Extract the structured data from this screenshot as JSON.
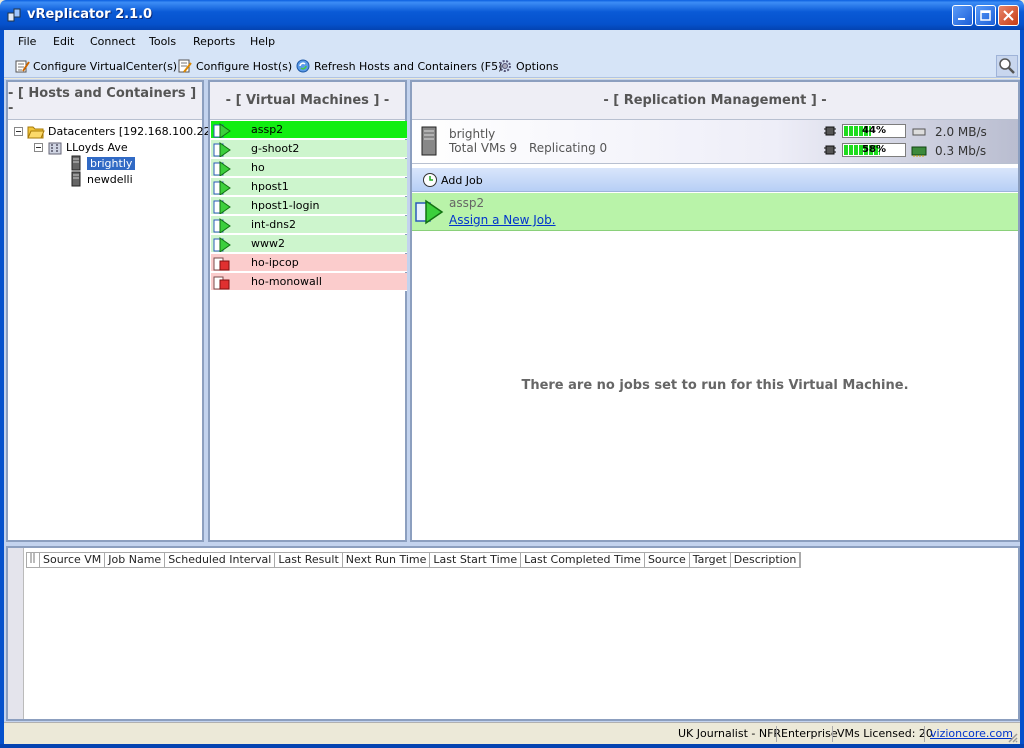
{
  "window": {
    "title": "vReplicator 2.1.0"
  },
  "menu": [
    "File",
    "Edit",
    "Connect",
    "Tools",
    "Reports",
    "Help"
  ],
  "toolbar": {
    "configure_vc": "Configure VirtualCenter(s)",
    "configure_hosts": "Configure Host(s)",
    "refresh": "Refresh Hosts and Containers (F5)",
    "options": "Options"
  },
  "panels": {
    "hosts": "- [ Hosts and Containers ] -",
    "vms": "- [ Virtual Machines ] -",
    "replication": "- [ Replication Management ] -"
  },
  "tree": {
    "root": "Datacenters [192.168.100.22]",
    "site": "LLoyds Ave",
    "hosts": [
      "brightly",
      "newdelli"
    ]
  },
  "vms": [
    {
      "name": "assp2",
      "state": "selected"
    },
    {
      "name": "g-shoot2",
      "state": "on"
    },
    {
      "name": "ho",
      "state": "on"
    },
    {
      "name": "hpost1",
      "state": "on"
    },
    {
      "name": "hpost1-login",
      "state": "on"
    },
    {
      "name": "int-dns2",
      "state": "on"
    },
    {
      "name": "www2",
      "state": "on"
    },
    {
      "name": "ho-ipcop",
      "state": "off"
    },
    {
      "name": "ho-monowall",
      "state": "off"
    }
  ],
  "host_info": {
    "name": "brightly",
    "total_vms": "Total VMs 9",
    "replicating": "Replicating 0",
    "cpu_pct": "44%",
    "cpu_level": 0.44,
    "mem_pct": "58%",
    "mem_level": 0.58,
    "disk_rate": "2.0 MB/s",
    "net_rate": "0.3 Mb/s"
  },
  "jobs": {
    "add_job": "Add Job",
    "vm_name": "assp2",
    "assign_link": "Assign a New Job.",
    "empty_message": "There are no jobs set to run for this Virtual Machine."
  },
  "job_table": {
    "columns": [
      "Source VM",
      "Job Name",
      "Scheduled Interval",
      "Last Result",
      "Next Run Time",
      "Last Start Time",
      "Last Completed Time",
      "Source",
      "Target",
      "Description"
    ]
  },
  "status": {
    "license_user": "UK Journalist - NFR",
    "edition": "Enterprise",
    "licensed": "VMs Licensed: 20",
    "link": "vizioncore.com"
  },
  "colors": {
    "accent": "#0551cc",
    "vm_on": "#cdf5cd",
    "vm_selected": "#11ee11",
    "vm_off": "#fbcccc"
  }
}
